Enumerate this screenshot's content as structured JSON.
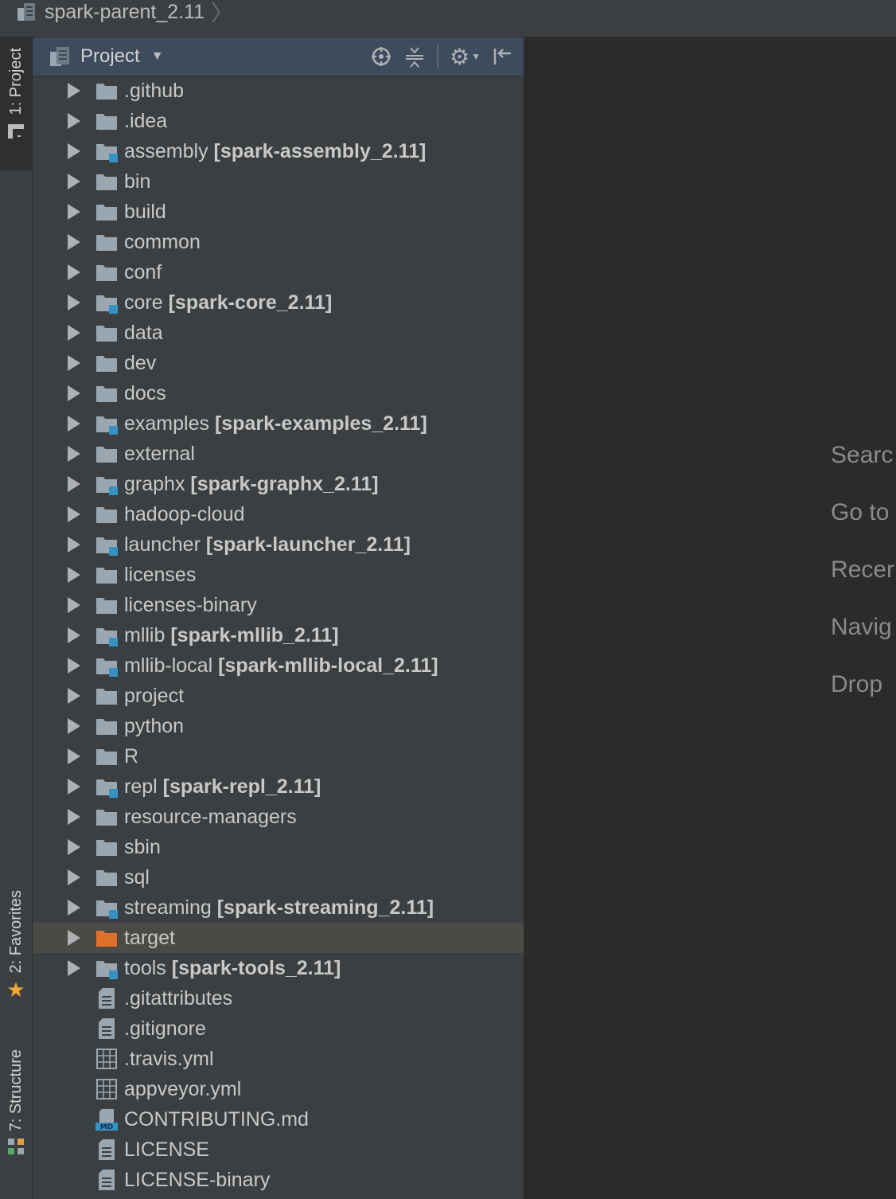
{
  "breadcrumb": {
    "project": "spark-parent_2.11"
  },
  "stripe": {
    "project_tab": "1: Project",
    "favorites_tab": "2: Favorites",
    "structure_tab": "7: Structure"
  },
  "panel": {
    "title": "Project"
  },
  "tree": [
    {
      "name": ".github",
      "module": "",
      "type": "folder",
      "expandable": true
    },
    {
      "name": ".idea",
      "module": "",
      "type": "folder",
      "expandable": true
    },
    {
      "name": "assembly",
      "module": "[spark-assembly_2.11]",
      "type": "module",
      "expandable": true
    },
    {
      "name": "bin",
      "module": "",
      "type": "folder",
      "expandable": true
    },
    {
      "name": "build",
      "module": "",
      "type": "folder",
      "expandable": true
    },
    {
      "name": "common",
      "module": "",
      "type": "folder",
      "expandable": true
    },
    {
      "name": "conf",
      "module": "",
      "type": "folder",
      "expandable": true
    },
    {
      "name": "core",
      "module": "[spark-core_2.11]",
      "type": "module",
      "expandable": true
    },
    {
      "name": "data",
      "module": "",
      "type": "folder",
      "expandable": true
    },
    {
      "name": "dev",
      "module": "",
      "type": "folder",
      "expandable": true
    },
    {
      "name": "docs",
      "module": "",
      "type": "folder",
      "expandable": true
    },
    {
      "name": "examples",
      "module": "[spark-examples_2.11]",
      "type": "module",
      "expandable": true
    },
    {
      "name": "external",
      "module": "",
      "type": "folder",
      "expandable": true
    },
    {
      "name": "graphx",
      "module": "[spark-graphx_2.11]",
      "type": "module",
      "expandable": true
    },
    {
      "name": "hadoop-cloud",
      "module": "",
      "type": "folder",
      "expandable": true
    },
    {
      "name": "launcher",
      "module": "[spark-launcher_2.11]",
      "type": "module",
      "expandable": true
    },
    {
      "name": "licenses",
      "module": "",
      "type": "folder",
      "expandable": true
    },
    {
      "name": "licenses-binary",
      "module": "",
      "type": "folder",
      "expandable": true
    },
    {
      "name": "mllib",
      "module": "[spark-mllib_2.11]",
      "type": "module",
      "expandable": true
    },
    {
      "name": "mllib-local",
      "module": "[spark-mllib-local_2.11]",
      "type": "module",
      "expandable": true
    },
    {
      "name": "project",
      "module": "",
      "type": "folder",
      "expandable": true
    },
    {
      "name": "python",
      "module": "",
      "type": "folder",
      "expandable": true
    },
    {
      "name": "R",
      "module": "",
      "type": "folder",
      "expandable": true
    },
    {
      "name": "repl",
      "module": "[spark-repl_2.11]",
      "type": "module",
      "expandable": true
    },
    {
      "name": "resource-managers",
      "module": "",
      "type": "folder",
      "expandable": true
    },
    {
      "name": "sbin",
      "module": "",
      "type": "folder",
      "expandable": true
    },
    {
      "name": "sql",
      "module": "",
      "type": "folder",
      "expandable": true
    },
    {
      "name": "streaming",
      "module": "[spark-streaming_2.11]",
      "type": "module",
      "expandable": true
    },
    {
      "name": "target",
      "module": "",
      "type": "excluded",
      "expandable": true,
      "selected": true
    },
    {
      "name": "tools",
      "module": "[spark-tools_2.11]",
      "type": "module",
      "expandable": true
    },
    {
      "name": ".gitattributes",
      "module": "",
      "type": "text",
      "expandable": false
    },
    {
      "name": ".gitignore",
      "module": "",
      "type": "text",
      "expandable": false
    },
    {
      "name": ".travis.yml",
      "module": "",
      "type": "yml",
      "expandable": false
    },
    {
      "name": "appveyor.yml",
      "module": "",
      "type": "yml",
      "expandable": false
    },
    {
      "name": "CONTRIBUTING.md",
      "module": "",
      "type": "md",
      "expandable": false
    },
    {
      "name": "LICENSE",
      "module": "",
      "type": "text",
      "expandable": false
    },
    {
      "name": "LICENSE-binary",
      "module": "",
      "type": "text",
      "expandable": false
    }
  ],
  "editor_hints": [
    "Searc",
    "Go to",
    "Recer",
    "Navig",
    "Drop"
  ],
  "colors": {
    "folder": "#9aa7b0",
    "excluded_folder": "#e0712b",
    "module_badge": "#3592c4",
    "selected_row": "#4b4a44",
    "panel_header": "#3d4b5c"
  },
  "icons": {
    "locate": "crosshair-icon",
    "collapse": "collapse-all-icon",
    "settings": "gear-icon",
    "hide": "hide-panel-icon"
  }
}
